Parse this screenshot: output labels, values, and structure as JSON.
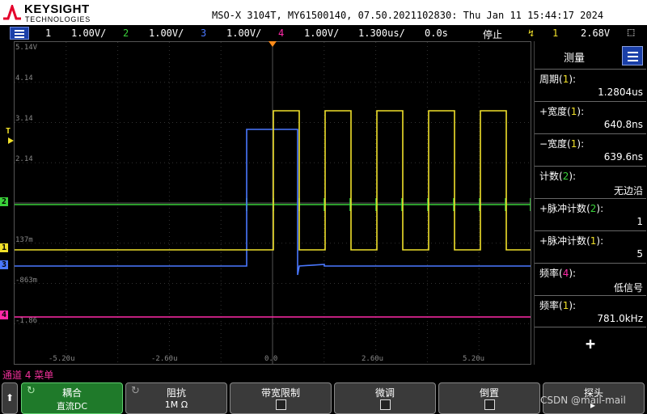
{
  "header": {
    "brand": "KEYSIGHT",
    "brand_sub": "TECHNOLOGIES",
    "instrument_info": "MSO-X 3104T, MY61500140, 07.50.2021102830: Thu Jan 11 15:44:17 2024"
  },
  "channel_bar": {
    "channels": [
      {
        "num": "1",
        "scale": "1.00V/",
        "color": "#f0e02a"
      },
      {
        "num": "2",
        "scale": "1.00V/",
        "color": "#3ad13a"
      },
      {
        "num": "3",
        "scale": "1.00V/",
        "color": "#4a78ff"
      },
      {
        "num": "4",
        "scale": "1.00V/",
        "color": "#ff2aa8"
      }
    ],
    "timebase": "1.300us/",
    "delay": "0.0s",
    "run_state": "停止",
    "trigger_source": "1",
    "trigger_level": "2.68V"
  },
  "graticule": {
    "voltage_labels": [
      "5.14V",
      "4.14",
      "3.14",
      "2.14",
      "137m",
      "-863m",
      "-1.86"
    ],
    "time_labels": [
      "-5.20u",
      "-2.60u",
      "0.0",
      "2.60u",
      "5.20u"
    ],
    "markers": {
      "trigger_level": "T",
      "ch1": "1",
      "ch2": "2",
      "ch3": "3",
      "ch4": "4"
    }
  },
  "measurements": {
    "title": "测量",
    "items": [
      {
        "label": "周期",
        "ch": "1",
        "value": "1.2804us",
        "color": "#f0e02a"
      },
      {
        "label": "+宽度",
        "ch": "1",
        "value": "640.8ns",
        "color": "#f0e02a"
      },
      {
        "label": "−宽度",
        "ch": "1",
        "value": "639.6ns",
        "color": "#f0e02a"
      },
      {
        "label": "计数",
        "ch": "2",
        "value": "无边沿",
        "color": "#3ad13a"
      },
      {
        "label": "+脉冲计数",
        "ch": "2",
        "value": "1",
        "color": "#3ad13a"
      },
      {
        "label": "+脉冲计数",
        "ch": "1",
        "value": "5",
        "color": "#f0e02a"
      },
      {
        "label": "频率",
        "ch": "4",
        "value": "低信号",
        "color": "#ff2aa8"
      },
      {
        "label": "频率",
        "ch": "1",
        "value": "781.0kHz",
        "color": "#f0e02a"
      }
    ],
    "add_label": "+"
  },
  "bottom": {
    "menu_label": "通道 4 菜单",
    "softkeys": {
      "coupling": {
        "title": "耦合",
        "value": "直流DC"
      },
      "impedance": {
        "title": "阻抗",
        "value": "1M Ω"
      },
      "bw_limit": {
        "title": "带宽限制"
      },
      "fine": {
        "title": "微调"
      },
      "invert": {
        "title": "倒置"
      },
      "probe": {
        "title": "探头"
      }
    },
    "watermark": "CSDN @mail-mail"
  }
}
